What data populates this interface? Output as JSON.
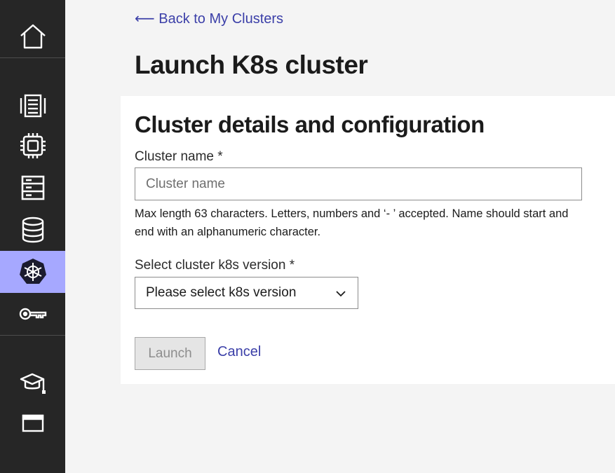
{
  "sidebar": {
    "items": [
      {
        "icon": "home-icon"
      },
      {
        "icon": "server-rack-icon"
      },
      {
        "icon": "chip-icon"
      },
      {
        "icon": "storage-list-icon"
      },
      {
        "icon": "database-icon"
      },
      {
        "icon": "kubernetes-icon",
        "active": true
      },
      {
        "icon": "key-icon"
      },
      {
        "icon": "graduation-cap-icon"
      },
      {
        "icon": "browser-window-icon"
      }
    ],
    "active_color": "#a6a8ff",
    "background": "#262626"
  },
  "header": {
    "back_link": "⟵ Back to My Clusters",
    "title": "Launch K8s cluster"
  },
  "form": {
    "title": "Cluster details and configuration",
    "cluster_name": {
      "label": "Cluster name *",
      "placeholder": "Cluster name",
      "value": "",
      "helper": "Max length 63 characters. Letters, numbers and ‘- ’ accepted. Name should start and end with an alphanumeric character."
    },
    "k8s_version": {
      "label": "Select cluster k8s version *",
      "selected": "Please select k8s version"
    },
    "launch_label": "Launch",
    "cancel_label": "Cancel"
  },
  "colors": {
    "link": "#3b3fa8",
    "page_background": "#f4f4f4"
  }
}
